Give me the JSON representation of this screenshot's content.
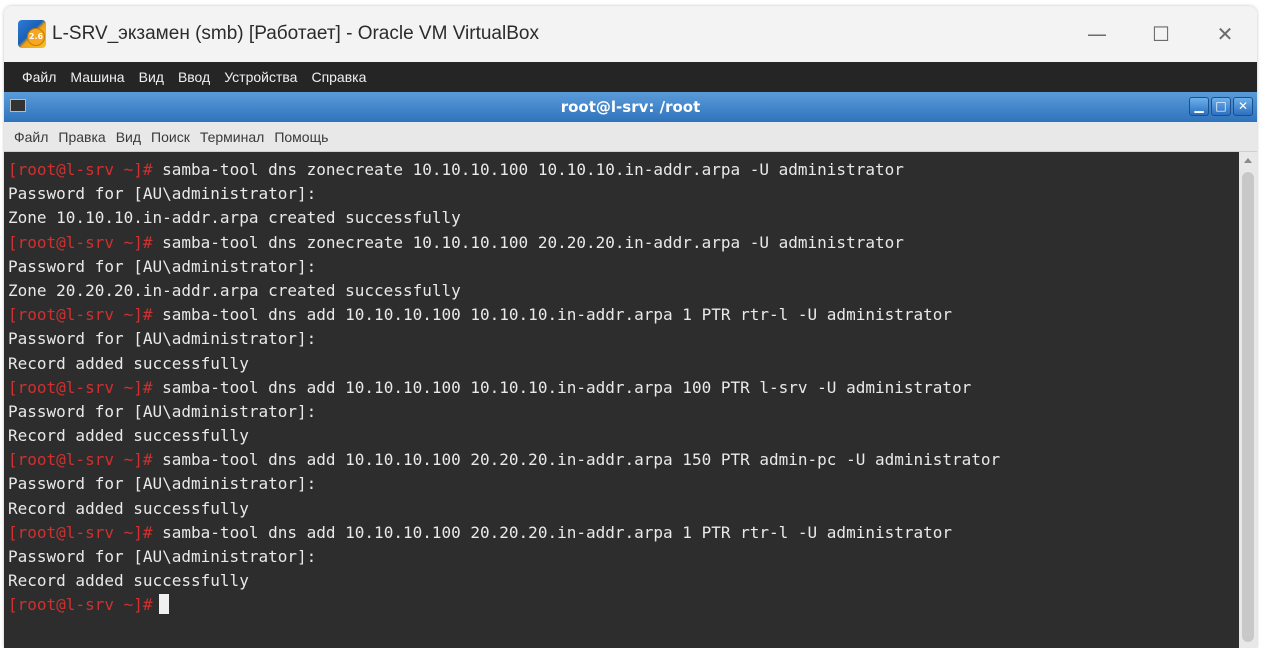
{
  "window": {
    "title": "L-SRV_экзамен (smb) [Работает] - Oracle VM VirtualBox",
    "app_icon": "virtualbox-icon",
    "app_icon_badge": "2.6",
    "controls": {
      "minimize": "—",
      "maximize": "☐",
      "close": "✕"
    }
  },
  "vbox_menu": [
    "Файл",
    "Машина",
    "Вид",
    "Ввод",
    "Устройства",
    "Справка"
  ],
  "terminal": {
    "title": "root@l-srv: /root",
    "controls": {
      "minimize": "▁",
      "maximize": "□",
      "close": "✕"
    },
    "menu": [
      "Файл",
      "Правка",
      "Вид",
      "Поиск",
      "Терминал",
      "Помощь"
    ],
    "prompt": "[root@l-srv ~]#",
    "lines": [
      {
        "prompt": "[root@l-srv ~]#",
        "text": " samba-tool dns zonecreate 10.10.10.100 10.10.10.in-addr.arpa -U administrator"
      },
      {
        "prompt": "",
        "text": "Password for [AU\\administrator]:"
      },
      {
        "prompt": "",
        "text": "Zone 10.10.10.in-addr.arpa created successfully"
      },
      {
        "prompt": "[root@l-srv ~]#",
        "text": " samba-tool dns zonecreate 10.10.10.100 20.20.20.in-addr.arpa -U administrator"
      },
      {
        "prompt": "",
        "text": "Password for [AU\\administrator]:"
      },
      {
        "prompt": "",
        "text": "Zone 20.20.20.in-addr.arpa created successfully"
      },
      {
        "prompt": "[root@l-srv ~]#",
        "text": " samba-tool dns add 10.10.10.100 10.10.10.in-addr.arpa 1 PTR rtr-l -U administrator"
      },
      {
        "prompt": "",
        "text": "Password for [AU\\administrator]:"
      },
      {
        "prompt": "",
        "text": "Record added successfully"
      },
      {
        "prompt": "[root@l-srv ~]#",
        "text": " samba-tool dns add 10.10.10.100 10.10.10.in-addr.arpa 100 PTR l-srv -U administrator"
      },
      {
        "prompt": "",
        "text": "Password for [AU\\administrator]:"
      },
      {
        "prompt": "",
        "text": "Record added successfully"
      },
      {
        "prompt": "[root@l-srv ~]#",
        "text": " samba-tool dns add 10.10.10.100 20.20.20.in-addr.arpa 150 PTR admin-pc -U administrator"
      },
      {
        "prompt": "",
        "text": "Password for [AU\\administrator]:"
      },
      {
        "prompt": "",
        "text": "Record added successfully"
      },
      {
        "prompt": "[root@l-srv ~]#",
        "text": " samba-tool dns add 10.10.10.100 20.20.20.in-addr.arpa 1 PTR rtr-l -U administrator"
      },
      {
        "prompt": "",
        "text": "Password for [AU\\administrator]:"
      },
      {
        "prompt": "",
        "text": "Record added successfully"
      }
    ]
  },
  "colors": {
    "prompt": "#d0302f",
    "terminal_bg": "#2d2d2d",
    "terminal_fg": "#e9e9e9",
    "title_accent": "#2f73bd"
  }
}
